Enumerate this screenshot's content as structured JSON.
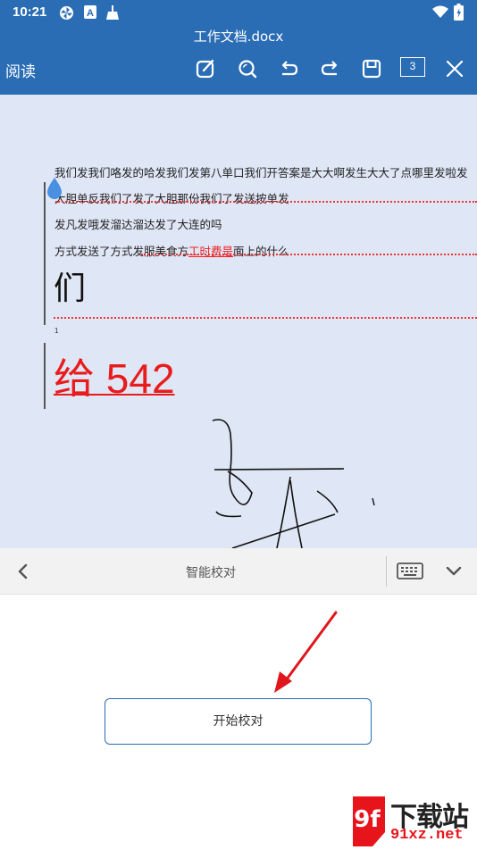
{
  "status_bar": {
    "time": "10:21",
    "icons": [
      "pinwheel-icon",
      "a-box-icon",
      "broom-icon",
      "wifi-icon",
      "battery-icon"
    ]
  },
  "app_bar": {
    "doc_title": "工作文档.docx",
    "read_label": "阅读",
    "tools": [
      "edit-icon",
      "search-icon",
      "undo-icon",
      "redo-icon",
      "save-icon",
      "page-count",
      "close-icon"
    ],
    "page_count": "3",
    "color": "#2a6db5"
  },
  "document": {
    "background": "#dfe6f5",
    "lines": [
      "我们发我们咯发的哈发我们发第八单口我们开答案是大大啊发生大大了点哪里发啦发",
      "大胆单反我们了发了大胆那份我们了发送按单发",
      "发凡发哦发溜达溜达发了大连的吗"
    ],
    "line4_before": "方式发送了方式发服美食方",
    "line4_red": "工时费是",
    "line4_after": "面上的什么",
    "big_char": "们",
    "small_number": "1",
    "big_red_text": "给 542",
    "revision_color": "#e22222"
  },
  "proofread_panel": {
    "title": "智能校对",
    "start_button": "开始校对",
    "icons": [
      "chevron-left-icon",
      "keyboard-icon",
      "chevron-down-icon"
    ]
  },
  "watermark": {
    "logo_text": "9f",
    "brand": "下载站",
    "domain": "91xz.net"
  }
}
